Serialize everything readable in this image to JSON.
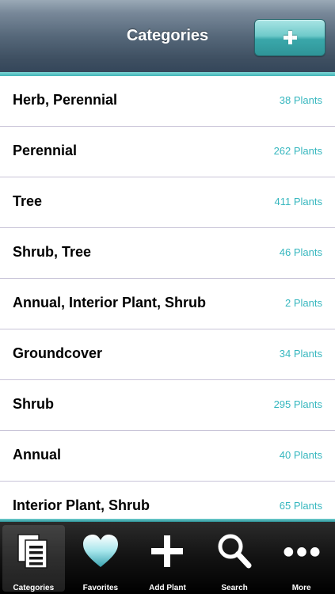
{
  "navbar": {
    "title": "Categories",
    "add_button_icon": "plus-icon"
  },
  "categories": [
    {
      "name": "Herb, Perennial",
      "count": "38 Plants"
    },
    {
      "name": "Perennial",
      "count": "262 Plants"
    },
    {
      "name": "Tree",
      "count": "411 Plants"
    },
    {
      "name": "Shrub, Tree",
      "count": "46 Plants"
    },
    {
      "name": "Annual, Interior Plant, Shrub",
      "count": "2 Plants"
    },
    {
      "name": "Groundcover",
      "count": "34 Plants"
    },
    {
      "name": "Shrub",
      "count": "295 Plants"
    },
    {
      "name": "Annual",
      "count": "40 Plants"
    },
    {
      "name": "Interior Plant, Shrub",
      "count": "65 Plants"
    }
  ],
  "tabbar": {
    "tabs": [
      {
        "label": "Categories",
        "icon": "documents-icon",
        "active": true
      },
      {
        "label": "Favorites",
        "icon": "heart-icon",
        "active": false
      },
      {
        "label": "Add Plant",
        "icon": "plus-icon",
        "active": false
      },
      {
        "label": "Search",
        "icon": "magnifier-icon",
        "active": false
      },
      {
        "label": "More",
        "icon": "ellipsis-icon",
        "active": false
      }
    ]
  },
  "colors": {
    "accent": "#37b7bf",
    "row_divider": "#c9c4d8"
  }
}
